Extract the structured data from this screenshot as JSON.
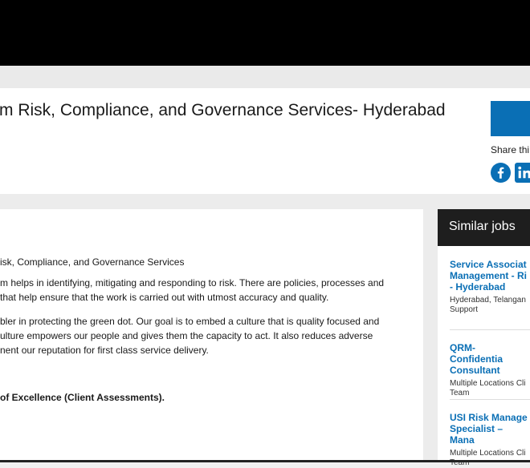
{
  "header": {
    "title": "rm Risk, Compliance, and Governance Services- Hyderabad",
    "share_label": "Share thi"
  },
  "social": {
    "facebook": "facebook-icon",
    "linkedin": "linkedin-icon",
    "linkedin_text": "in"
  },
  "description": {
    "line1": "isk, Compliance, and Governance Services",
    "para2_line1": "m helps in identifying, mitigating and responding to risk. There are policies, processes and",
    "para2_line2": " that help ensure that the work is carried out with utmost accuracy and quality.",
    "para3_line1": "bler in protecting the green dot. Our goal is to embed a culture that is quality focused and",
    "para3_line2": "ulture empowers our people and gives them the capacity to act. It also reduces adverse",
    "para3_line3": "nent our reputation for first class service delivery.",
    "bold_line": "of Excellence (Client Assessments)."
  },
  "similar_jobs": {
    "title": "Similar jobs",
    "items": [
      {
        "title": "Service Associat\nManagement - Ri\n- Hyderabad",
        "meta": "Hyderabad, Telangan\nSupport"
      },
      {
        "title": "QRM- Confidentia\nConsultant",
        "meta": "Multiple Locations Cli\nTeam"
      },
      {
        "title": "USI Risk Manage\nSpecialist – Mana",
        "meta": "Multiple Locations Cli\nTeam"
      }
    ]
  },
  "colors": {
    "accent": "#0a6fb5",
    "topbar": "#000000",
    "sidebar_header": "#1e1e1e"
  }
}
